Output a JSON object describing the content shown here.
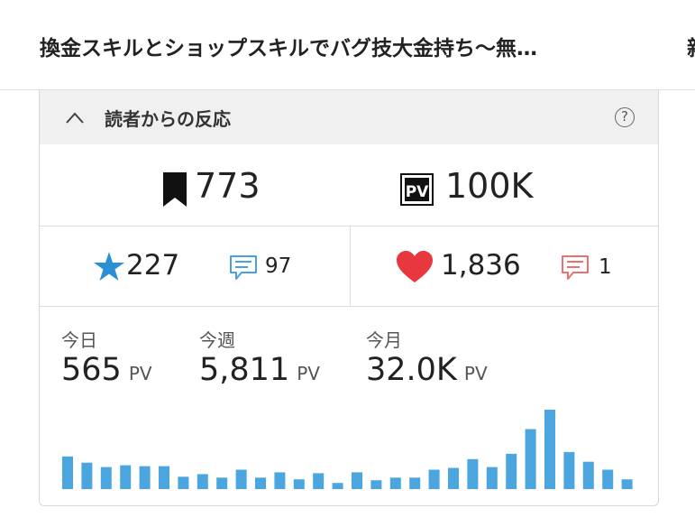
{
  "article": {
    "title": "換金スキルとショップスキルでバグ技大金持ち〜無…",
    "next_title_fragment": "新"
  },
  "panel": {
    "title": "読者からの反応",
    "help": "?",
    "collapse_icon": "chevron-up-icon",
    "bookmarks": "773",
    "pageviews": "100K",
    "stars": "227",
    "star_comments": "97",
    "likes": "1,836",
    "like_comments": "1"
  },
  "stats": {
    "today_label": "今日",
    "today_value": "565",
    "today_unit": "PV",
    "week_label": "今週",
    "week_value": "5,811",
    "week_unit": "PV",
    "month_label": "今月",
    "month_value": "32.0K",
    "month_unit": "PV"
  },
  "colors": {
    "star": "#2a8fd4",
    "comment_blue": "#4a9fe0",
    "heart": "#e8373f",
    "comment_red": "#ee6f6f",
    "bar": "#4ba6df"
  },
  "chart_data": {
    "type": "bar",
    "title": "",
    "values": [
      37,
      30,
      25,
      27,
      26,
      26,
      14,
      17,
      13,
      22,
      13,
      19,
      11,
      18,
      7,
      19,
      10,
      13,
      13,
      22,
      24,
      34,
      25,
      40,
      68,
      90,
      42,
      31,
      22,
      11
    ]
  }
}
